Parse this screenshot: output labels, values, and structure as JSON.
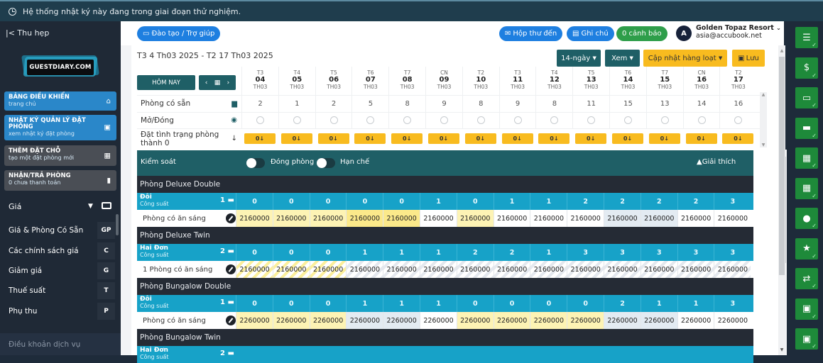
{
  "banner": {
    "icon": "clock-icon",
    "text": "Hệ thống nhật ký này đang trong giai đoạn thử nghiệm."
  },
  "sidebar": {
    "collapse_label": "|< Thu hẹp",
    "logo_text": "GUESTDIARY.COM",
    "cards": [
      {
        "title": "BẢNG ĐIỀU KHIỂN",
        "subtitle": "trang chủ",
        "icon": "home-icon",
        "style": "blue"
      },
      {
        "title": "NHẬT KÝ QUẢN LÝ ĐẶT PHÒNG",
        "subtitle": "xem nhật ký đặt phòng",
        "icon": "book-icon",
        "style": "blue"
      },
      {
        "title": "THÊM ĐẶT CHỖ",
        "subtitle": "tạo một đặt phòng mới",
        "icon": "calendar-plus-icon",
        "style": "grey"
      },
      {
        "title": "NHẬN/TRẢ PHÒNG",
        "subtitle": "0 chưa thanh toán",
        "icon": "door-icon",
        "style": "grey"
      }
    ],
    "price_section": {
      "label": "Giá",
      "icon": "cash-icon"
    },
    "items": [
      {
        "label": "Giá & Phòng Có Sẵn",
        "key": "GP"
      },
      {
        "label": "Các chính sách giá",
        "key": "C"
      },
      {
        "label": "Giảm giá",
        "key": "G"
      },
      {
        "label": "Thuế suất",
        "key": "T"
      },
      {
        "label": "Phụ thu",
        "key": "P"
      }
    ],
    "terms": "Điều khoản dịch vụ"
  },
  "topbar": {
    "training_label": "Đào tạo / Trợ giúp",
    "inbox_label": "Hộp thư đến",
    "notes_label": "Ghi chú",
    "alerts_label": "0 cảnh báo",
    "avatar_letter": "A",
    "account_name": "Golden Topaz Resort",
    "account_email": "asia@accubook.net"
  },
  "toolbar": {
    "date_range": "T3 4 Th03 2025  -  T2 17 Th03 2025",
    "range_select": "14-ngày",
    "view_select": "Xem",
    "bulk_update": "Cập nhật hàng loạt",
    "save": "Lưu",
    "today": "HÔM NAY"
  },
  "dates": [
    {
      "dow": "T3",
      "day": "04",
      "month": "TH03"
    },
    {
      "dow": "T4",
      "day": "05",
      "month": "TH03"
    },
    {
      "dow": "T5",
      "day": "06",
      "month": "TH03"
    },
    {
      "dow": "T6",
      "day": "07",
      "month": "TH03"
    },
    {
      "dow": "T7",
      "day": "08",
      "month": "TH03"
    },
    {
      "dow": "CN",
      "day": "09",
      "month": "TH03"
    },
    {
      "dow": "T2",
      "day": "10",
      "month": "TH03"
    },
    {
      "dow": "T3",
      "day": "11",
      "month": "TH03"
    },
    {
      "dow": "T4",
      "day": "12",
      "month": "TH03"
    },
    {
      "dow": "T5",
      "day": "13",
      "month": "TH03"
    },
    {
      "dow": "T6",
      "day": "14",
      "month": "TH03"
    },
    {
      "dow": "T7",
      "day": "15",
      "month": "TH03"
    },
    {
      "dow": "CN",
      "day": "16",
      "month": "TH03"
    },
    {
      "dow": "T2",
      "day": "17",
      "month": "TH03"
    }
  ],
  "summary_rows": {
    "available_label": "Phòng có sẵn",
    "available": [
      "2",
      "1",
      "2",
      "5",
      "8",
      "9",
      "8",
      "9",
      "8",
      "11",
      "15",
      "13",
      "14",
      "16"
    ],
    "open_close_label": "Mở/Đóng",
    "set_zero_label": "Đặt tình trạng phòng thành 0",
    "set_zero_button": "0↓"
  },
  "control": {
    "label": "Kiểm soát",
    "close_rooms_label": "Đóng phòng",
    "restrict_label": "Hạn chế",
    "explain_label": "Giải thích"
  },
  "rooms": [
    {
      "name": "Phòng Deluxe Double",
      "bed_type": "Đôi",
      "capacity_label": "Công suất",
      "bed_count": "1",
      "availability": [
        "0",
        "0",
        "0",
        "0",
        "0",
        "1",
        "0",
        "1",
        "1",
        "2",
        "2",
        "2",
        "2",
        "3"
      ],
      "rate_name": "Phòng có ăn sáng",
      "prices": [
        "2160000",
        "2160000",
        "2160000",
        "2160000",
        "2160000",
        "2160000",
        "2160000",
        "2160000",
        "2160000",
        "2160000",
        "2160000",
        "2160000",
        "2160000",
        "2160000"
      ],
      "cell_styles": [
        "yellow",
        "yellow",
        "yellow",
        "yellow2",
        "yellow2",
        "white",
        "yellow",
        "white",
        "white",
        "white",
        "blue",
        "blue",
        "white",
        "white"
      ]
    },
    {
      "name": "Phòng Deluxe Twin",
      "bed_type": "Hai Đơn",
      "capacity_label": "Công suất",
      "bed_count": "2",
      "availability": [
        "0",
        "0",
        "0",
        "1",
        "1",
        "1",
        "2",
        "2",
        "1",
        "3",
        "3",
        "3",
        "3",
        "3"
      ],
      "rate_name": "1 Phòng có ăn sáng",
      "prices": [
        "2160000",
        "2160000",
        "2160000",
        "2160000",
        "2160000",
        "2160000",
        "2160000",
        "2160000",
        "2160000",
        "2160000",
        "2160000",
        "2160000",
        "2160000",
        "2160000"
      ],
      "cell_styles": [
        "stripe-y",
        "stripe-y",
        "stripe-y",
        "stripe-g",
        "stripe-g",
        "stripe-g",
        "stripe-g",
        "stripe-g",
        "stripe-g",
        "stripe-g",
        "stripe-g",
        "stripe-g",
        "stripe-g",
        "stripe-g"
      ]
    },
    {
      "name": "Phòng Bungalow Double",
      "bed_type": "Đôi",
      "capacity_label": "Công suất",
      "bed_count": "1",
      "availability": [
        "0",
        "0",
        "0",
        "1",
        "1",
        "1",
        "0",
        "0",
        "0",
        "0",
        "2",
        "1",
        "1",
        "3"
      ],
      "rate_name": "Phòng có ăn sáng",
      "prices": [
        "2260000",
        "2260000",
        "2260000",
        "2260000",
        "2260000",
        "2260000",
        "2260000",
        "2260000",
        "2260000",
        "2260000",
        "2260000",
        "2260000",
        "2260000",
        "2260000"
      ],
      "cell_styles": [
        "yellow",
        "yellow",
        "yellow",
        "blue",
        "blue",
        "white",
        "yellow",
        "yellow",
        "yellow",
        "yellow",
        "blue",
        "blue",
        "white",
        "white"
      ]
    },
    {
      "name": "Phòng Bungalow Twin",
      "bed_type": "Hai Đơn",
      "capacity_label": "Công suất",
      "bed_count": "2"
    }
  ],
  "right_bar": [
    "checklist-icon",
    "money-check-icon",
    "payment-card-icon",
    "card-check-icon",
    "calendar-check-icon",
    "calendar-dollar-icon",
    "chat-check-icon",
    "star-check-icon",
    "transfer-check-icon",
    "id-card-check-icon",
    "id-card-check-icon-2"
  ]
}
